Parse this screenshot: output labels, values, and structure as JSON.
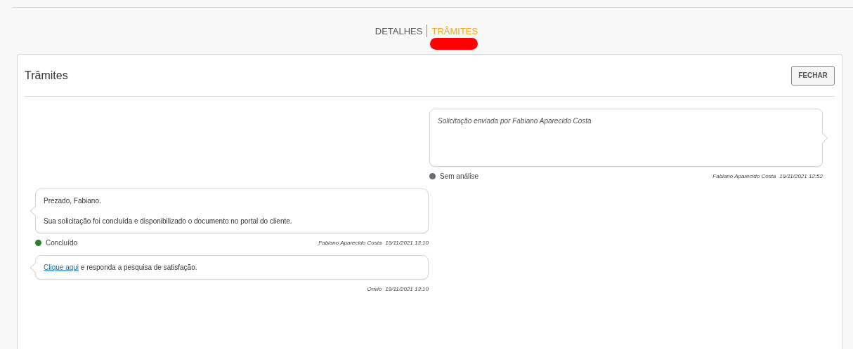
{
  "tabs": [
    {
      "label": "DETALHES",
      "selected": false
    },
    {
      "label": "TRÂMITES",
      "selected": true
    }
  ],
  "panel": {
    "title": "Trâmites",
    "close_button": "FECHAR"
  },
  "messages": [
    {
      "kind": "sent",
      "paragraphs": [
        {
          "text": "Solicitação enviada por Fabiano Aparecido Costa"
        }
      ],
      "status": {
        "label": "Sem análise",
        "color": "#6b6b73"
      },
      "author": "Fabiano Aparecido Costa",
      "date": "19/11/2021 12:52"
    },
    {
      "kind": "received",
      "paragraphs": [
        {
          "text": "Prezado, Fabiano."
        },
        {
          "text": "Sua solicitação foi concluída e disponibilizado o documento no portal do cliente."
        }
      ],
      "status": {
        "label": "Concluído",
        "color": "#2e7d32"
      },
      "author": "Fabiano Aparecido Costa",
      "date": "19/11/2021 13:10"
    },
    {
      "kind": "received",
      "paragraphs": [
        {
          "link": "Clique aqui",
          "text": " e responda a pesquisa de satisfação."
        }
      ],
      "author": "Onvio",
      "date": "19/11/2021 13:10"
    }
  ]
}
